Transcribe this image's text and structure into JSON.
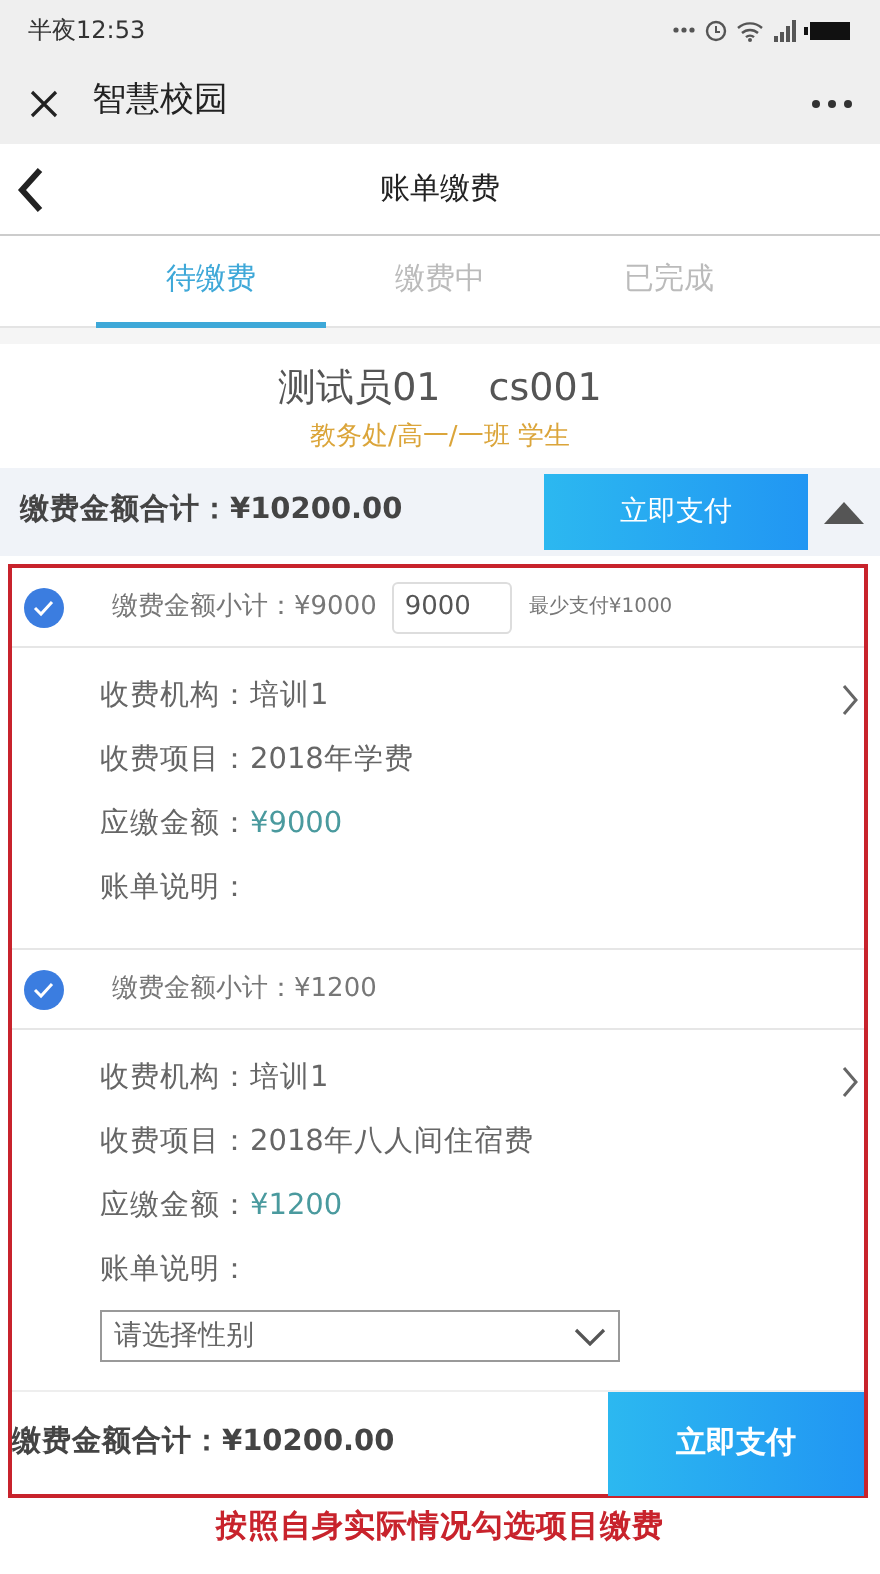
{
  "status_bar": {
    "time": "半夜12:53"
  },
  "app_header": {
    "title": "智慧校园"
  },
  "page_header": {
    "title": "账单缴费"
  },
  "tabs": [
    {
      "label": "待缴费",
      "selected": true
    },
    {
      "label": "缴费中",
      "selected": false
    },
    {
      "label": "已完成",
      "selected": false
    }
  ],
  "user": {
    "name": "测试员01",
    "id": "cs001",
    "department": "教务处/高一/一班 学生"
  },
  "summary": {
    "total": "缴费金额合计：¥10200.00",
    "pay_button": "立即支付"
  },
  "bills": [
    {
      "checked": true,
      "subtotal": "缴费金额小计：¥9000",
      "amount_input": "9000",
      "min_note": "最少支付¥1000",
      "fields": [
        {
          "kind": "plain",
          "label": "收费机构：",
          "value": "培训1"
        },
        {
          "kind": "plain",
          "label": "收费项目：",
          "value": "2018年学费"
        },
        {
          "kind": "amount",
          "label": "应缴金额：",
          "value": "¥9000"
        },
        {
          "kind": "plain",
          "label": "账单说明："
        }
      ]
    },
    {
      "checked": true,
      "subtotal": "缴费金额小计：¥1200",
      "fields": [
        {
          "kind": "plain",
          "label": "收费机构：",
          "value": "培训1"
        },
        {
          "kind": "plain",
          "label": "收费项目：",
          "value": "2018年八人间住宿费"
        },
        {
          "kind": "amount",
          "label": "应缴金额：",
          "value": "¥1200"
        },
        {
          "kind": "plain",
          "label": "账单说明："
        }
      ],
      "select": {
        "placeholder": "请选择性别"
      }
    }
  ],
  "footer": {
    "total": "缴费金额合计：¥10200.00",
    "pay_button": "立即支付"
  },
  "annotation": {
    "caption": "按照自身实际情况勾选项目缴费"
  }
}
